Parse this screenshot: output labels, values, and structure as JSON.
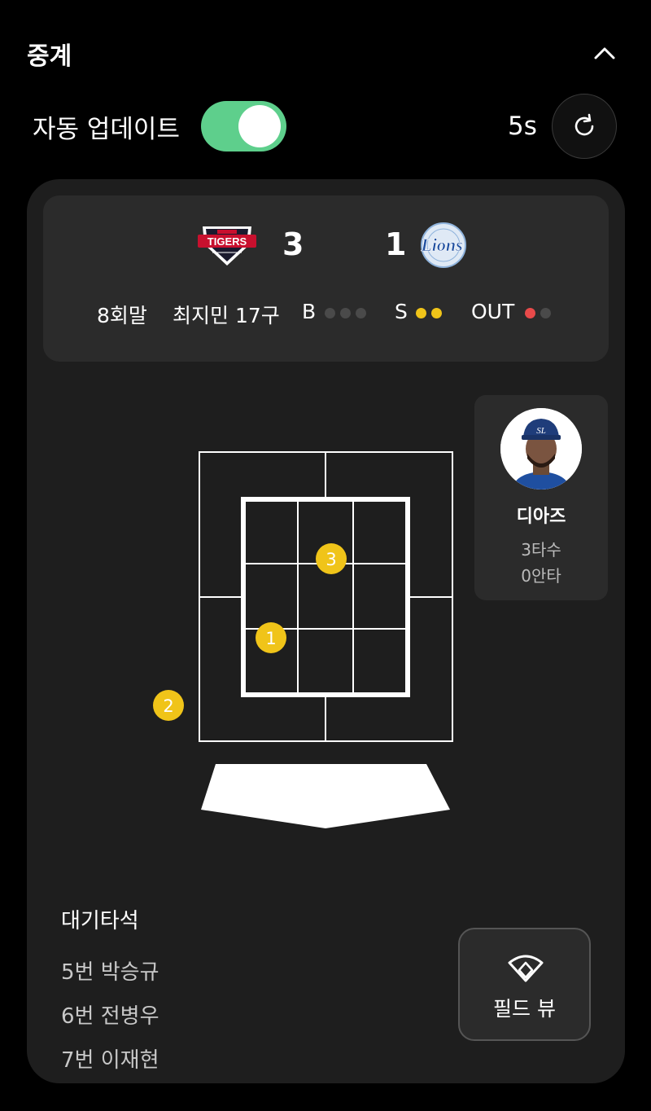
{
  "header": {
    "title": "중계"
  },
  "auto_update": {
    "label": "자동 업데이트",
    "enabled": true,
    "interval": "5s"
  },
  "scoreboard": {
    "home": {
      "team": "TIGERS",
      "score": "3"
    },
    "away": {
      "team": "LIONS",
      "score": "1"
    },
    "inning": "8회말",
    "pitcher": "최지민 17구",
    "balls_label": "B",
    "balls": 0,
    "strikes_label": "S",
    "strikes": 2,
    "outs_label": "OUT",
    "outs": 1
  },
  "pitches": [
    {
      "number": "1"
    },
    {
      "number": "2"
    },
    {
      "number": "3"
    }
  ],
  "batter": {
    "name": "디아즈",
    "at_bats": "3타수",
    "hits": "0안타"
  },
  "on_deck": {
    "title": "대기타석",
    "players": [
      "5번 박승규",
      "6번 전병우",
      "7번 이재현"
    ]
  },
  "field_view": {
    "label": "필드 뷰"
  },
  "colors": {
    "toggle_on": "#5ecf8c",
    "ball_marker": "#f0c419",
    "out_dot": "#e84a4a"
  }
}
